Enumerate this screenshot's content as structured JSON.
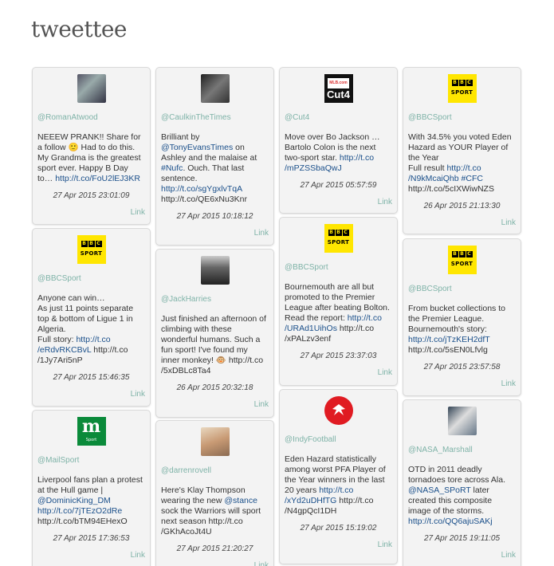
{
  "app": {
    "title": "tweettee",
    "link_label": "Link"
  },
  "columns": [
    [
      {
        "handle": "@RomanAtwood",
        "avatar": "roman-photo",
        "text_parts": [
          [
            "t",
            "NEEEW PRANK!! Share for a follow 🙂 Had to do this. My Grandma is the greatest sport ever. Happy B Day to… "
          ],
          [
            "a",
            "http://t.co/FoU2lEJ3KR"
          ]
        ],
        "date": "27 Apr 2015 23:01:09"
      },
      {
        "handle": "@BBCSport",
        "avatar": "bbc-sport",
        "text_parts": [
          [
            "t",
            "Anyone can win…\nAs just 11 points separate top & bottom of Ligue 1 in Algeria.\nFull story: "
          ],
          [
            "a",
            "http://t.co /eRdvRKCBvL"
          ],
          [
            "t",
            " http://t.co /1Jy7Ari5nP"
          ]
        ],
        "date": "27 Apr 2015 15:46:35"
      },
      {
        "handle": "@MailSport",
        "avatar": "mail-sport",
        "text_parts": [
          [
            "t",
            "Liverpool fans plan a protest at the Hull game | "
          ],
          [
            "a",
            "@DominicKing_DM"
          ],
          [
            "t",
            " "
          ],
          [
            "a",
            "http://t.co/7jTEzO2dRe"
          ],
          [
            "t",
            " http://t.co/bTM94EHexO"
          ]
        ],
        "date": "27 Apr 2015 17:36:53"
      }
    ],
    [
      {
        "handle": "@CaulkinTheTimes",
        "avatar": "caulkin-photo",
        "text_parts": [
          [
            "t",
            "Brilliant by "
          ],
          [
            "a",
            "@TonyEvansTimes"
          ],
          [
            "t",
            " on Ashley and the malaise at "
          ],
          [
            "a",
            "#Nufc"
          ],
          [
            "t",
            ". Ouch. That last sentence. "
          ],
          [
            "a",
            "http://t.co/sgYgxlvTqA"
          ],
          [
            "t",
            " http://t.co/QE6xNu3Knr"
          ]
        ],
        "date": "27 Apr 2015 10:18:12"
      },
      {
        "handle": "@JackHarries",
        "avatar": "jack-photo",
        "text_parts": [
          [
            "t",
            "Just finished an afternoon of climbing with these wonderful humans. Such a fun sport! I've found my inner monkey! 🐵 http://t.co /5xDBLc8Ta4"
          ]
        ],
        "date": "26 Apr 2015 20:32:18"
      },
      {
        "handle": "@darrenrovell",
        "avatar": "darren-photo",
        "text_parts": [
          [
            "t",
            "Here's Klay Thompson wearing the new "
          ],
          [
            "a",
            "@stance"
          ],
          [
            "t",
            " sock the Warriors will sport next season http://t.co /GKhAcoJt4U"
          ]
        ],
        "date": "27 Apr 2015 21:20:27"
      }
    ],
    [
      {
        "handle": "@Cut4",
        "avatar": "cut4-logo",
        "text_parts": [
          [
            "t",
            "Move over Bo Jackson … Bartolo Colon is the next two-sport star. "
          ],
          [
            "a",
            "http://t.co /mPZSSbaQwJ"
          ]
        ],
        "date": "27 Apr 2015 05:57:59"
      },
      {
        "handle": "@BBCSport",
        "avatar": "bbc-sport",
        "text_parts": [
          [
            "t",
            "Bournemouth are all but promoted to the Premier League after beating Bolton. Read the report: "
          ],
          [
            "a",
            "http://t.co /URAd1UihOs"
          ],
          [
            "t",
            " http://t.co /xPALzv3enf"
          ]
        ],
        "date": "27 Apr 2015 23:37:03"
      },
      {
        "handle": "@IndyFootball",
        "avatar": "indy-logo",
        "text_parts": [
          [
            "t",
            "Eden Hazard statistically among worst PFA Player of the Year winners in the last 20 years "
          ],
          [
            "a",
            "http://t.co /xYd2uDHfTG"
          ],
          [
            "t",
            " http://t.co /N4gpQcI1DH"
          ]
        ],
        "date": "27 Apr 2015 15:19:02"
      }
    ],
    [
      {
        "handle": "@BBCSport",
        "avatar": "bbc-sport",
        "text_parts": [
          [
            "t",
            "With 34.5% you voted Eden Hazard as YOUR Player of the Year\nFull result "
          ],
          [
            "a",
            "http://t.co /N9kMcaiQhb"
          ],
          [
            "t",
            " "
          ],
          [
            "a",
            "#CFC"
          ],
          [
            "t",
            " http://t.co/5cIXWiwNZS"
          ]
        ],
        "date": "26 Apr 2015 21:13:30"
      },
      {
        "handle": "@BBCSport",
        "avatar": "bbc-sport",
        "text_parts": [
          [
            "t",
            "From bucket collections to the Premier League. Bournemouth's story: "
          ],
          [
            "a",
            "http://t.co/jTzKEH2dfT"
          ],
          [
            "t",
            " http://t.co/5sEN0Lfvlg"
          ]
        ],
        "date": "27 Apr 2015 23:57:58"
      },
      {
        "handle": "@NASA_Marshall",
        "avatar": "astronaut-photo",
        "text_parts": [
          [
            "t",
            "OTD in 2011 deadly tornadoes tore across Ala. "
          ],
          [
            "a",
            "@NASA_SPoRT"
          ],
          [
            "t",
            " later created this composite image of the storms. "
          ],
          [
            "a",
            "http://t.co/QQ6ajuSAKj"
          ]
        ],
        "date": "27 Apr 2015 19:11:05"
      }
    ]
  ],
  "colors": {
    "handle": "#7fb3a8",
    "link": "#1a4f8a",
    "card_bg": "#f3f3f3",
    "bbc_yellow": "#ffe600"
  }
}
